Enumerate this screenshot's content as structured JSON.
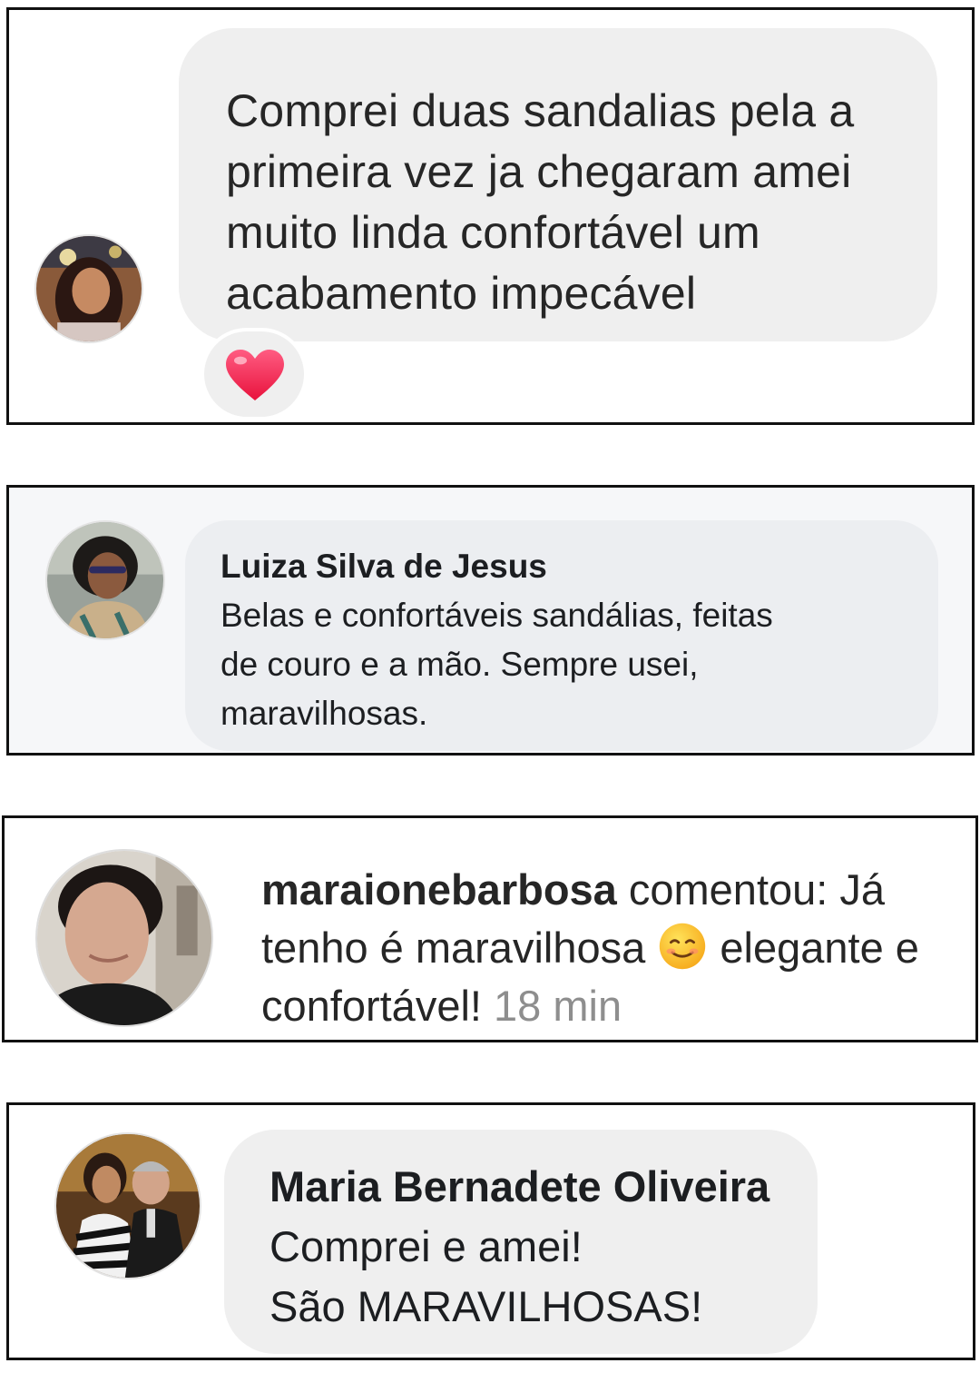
{
  "comments": [
    {
      "lines": [
        "Comprei duas sandalias pela a",
        "primeira vez ja chegaram amei",
        "muito linda confortável um",
        "acabamento impecável"
      ],
      "reaction": "heart-icon"
    },
    {
      "author": "Luiza Silva de Jesus",
      "lines": [
        "Belas e confortáveis sandálias, feitas",
        "de couro e a mão.  Sempre usei,",
        "maravilhosas."
      ]
    },
    {
      "username": "maraionebarbosa",
      "line1_rest": " comentou: Já",
      "line2_before": "tenho é maravilhosa ",
      "emoji": "☺️",
      "line2_after": " elegante e",
      "line3": "confortável! ",
      "time": "18 min"
    },
    {
      "author": "Maria Bernadete Oliveira",
      "lines": [
        "Comprei e amei!",
        "São MARAVILHOSAS!"
      ]
    }
  ],
  "colors": {
    "bubble": "#efefef",
    "heart": "#f0325a",
    "time": "#8e8e8e"
  }
}
